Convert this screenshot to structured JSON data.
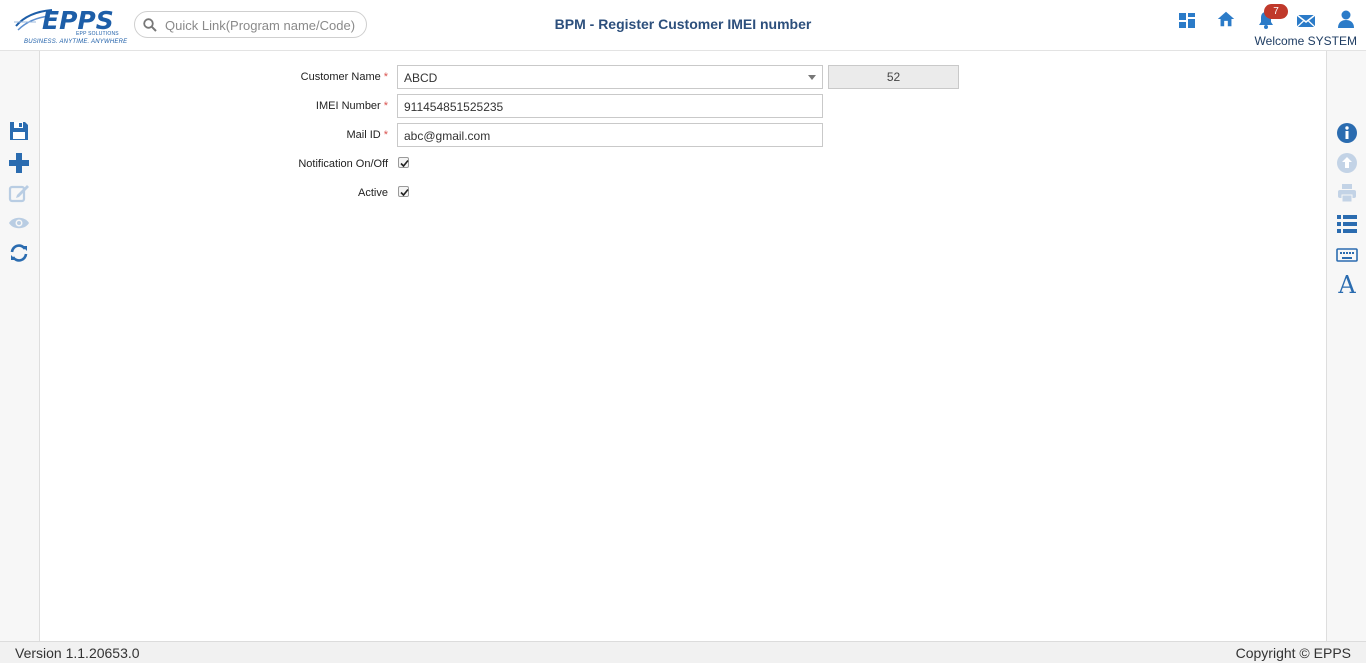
{
  "header": {
    "logo_text": "EPPS",
    "logo_sub": "EPP SOLUTIONS",
    "logo_tagline": "BUSINESS. ANYTIME. ANYWHERE",
    "search_placeholder": "Quick Link(Program name/Code)",
    "page_title": "BPM - Register Customer IMEI number",
    "notification_count": "7",
    "welcome_text": "Welcome SYSTEM",
    "icons": [
      "dashboard-icon",
      "home-icon",
      "bell-icon",
      "mail-icon",
      "user-icon"
    ]
  },
  "left_toolbar": {
    "icons": [
      "save-icon",
      "add-icon",
      "edit-icon",
      "view-icon",
      "refresh-icon"
    ]
  },
  "right_toolbar": {
    "icons": [
      "info-icon",
      "upload-icon",
      "print-icon",
      "list-icon",
      "keyboard-icon",
      "font-icon"
    ]
  },
  "form": {
    "customer_name_label": "Customer Name",
    "customer_name_value": "ABCD",
    "customer_code": "52",
    "imei_label": "IMEI Number",
    "imei_value": "911454851525235",
    "mail_label": "Mail ID",
    "mail_value": "abc@gmail.com",
    "notification_label": "Notification On/Off",
    "notification_checked": true,
    "active_label": "Active",
    "active_checked": true,
    "required_mark": "*"
  },
  "footer": {
    "version": "Version 1.1.20653.0",
    "copyright": "Copyright © EPPS"
  },
  "colors": {
    "brand": "#1d5ea8",
    "title": "#2c4f7c",
    "icon_blue": "#2b7bc8",
    "badge": "#c0392b",
    "required": "#d9534f"
  }
}
